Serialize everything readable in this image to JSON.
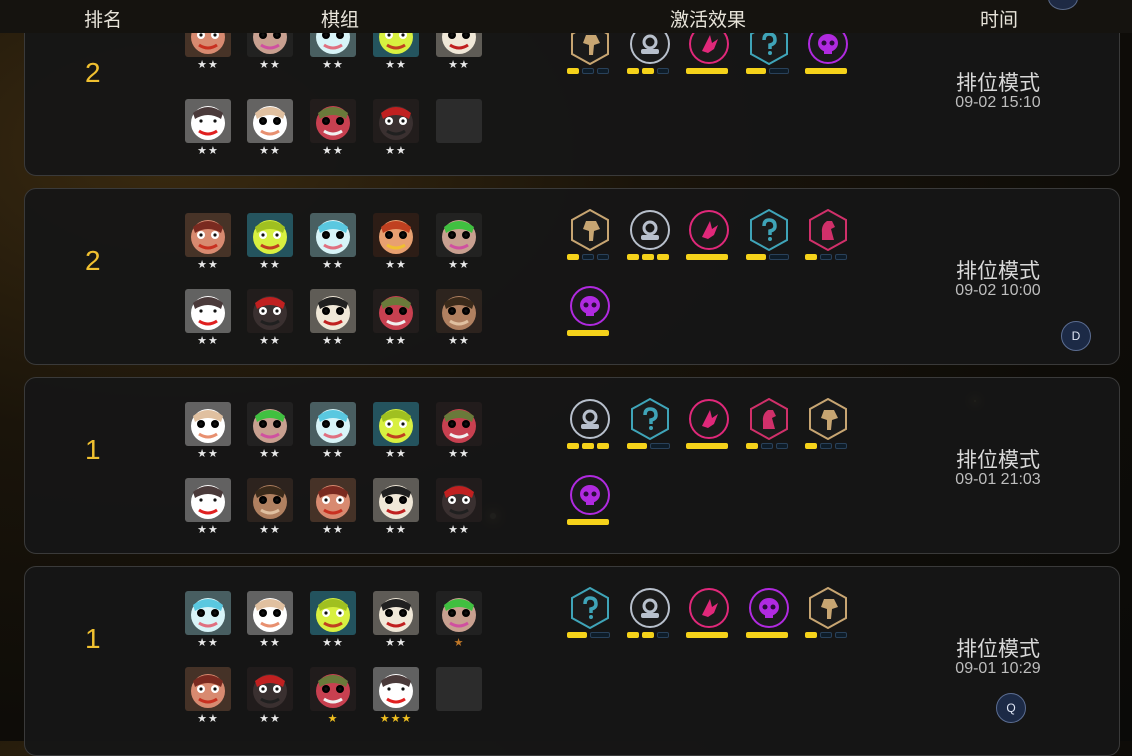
{
  "header": {
    "rank": "排名",
    "comp": "棋组",
    "traits": "激活效果",
    "time": "时间"
  },
  "rows": [
    {
      "rank": "2",
      "mode": "排位模式",
      "time": "09-02 15:10",
      "avatar": "",
      "units": [
        {
          "name": "red-beard-brawler",
          "stars": "★★",
          "star_color": "silver"
        },
        {
          "name": "green-horned-ogre",
          "stars": "★★",
          "star_color": "silver"
        },
        {
          "name": "frost-bear",
          "stars": "★★",
          "star_color": "silver"
        },
        {
          "name": "yellow-frog-mage",
          "stars": "★★",
          "star_color": "silver"
        },
        {
          "name": "skull-warrior",
          "stars": "★★",
          "star_color": "silver"
        },
        {
          "name": "horned-tusk-beast",
          "stars": "★★",
          "star_color": "silver"
        },
        {
          "name": "white-sheep",
          "stars": "★★",
          "star_color": "silver"
        },
        {
          "name": "horned-red-demon",
          "stars": "★★",
          "star_color": "silver"
        },
        {
          "name": "red-hat-bandit",
          "stars": "★★",
          "star_color": "silver"
        },
        {
          "name": "empty-slot",
          "stars": "",
          "star_color": "silver"
        }
      ],
      "traits": [
        {
          "icon": "axe-icon",
          "color": "#c7a572",
          "active": 1,
          "total": 3
        },
        {
          "icon": "helmet-icon",
          "color": "#b8c0cc",
          "active": 2,
          "total": 3
        },
        {
          "icon": "bird-icon",
          "color": "#e0287a",
          "active": 1,
          "total": 1
        },
        {
          "icon": "question-icon",
          "color": "#3fa4b8",
          "active": 1,
          "total": 2
        },
        {
          "icon": "skull-icon",
          "color": "#b02ae0",
          "active": 1,
          "total": 1
        }
      ]
    },
    {
      "rank": "2",
      "mode": "排位模式",
      "time": "09-02 10:00",
      "avatar": "D",
      "units": [
        {
          "name": "red-beard-brawler",
          "stars": "★★",
          "star_color": "silver"
        },
        {
          "name": "yellow-frog-mage",
          "stars": "★★",
          "star_color": "silver"
        },
        {
          "name": "frost-bear",
          "stars": "★★",
          "star_color": "silver"
        },
        {
          "name": "orange-headband-fighter",
          "stars": "★★",
          "star_color": "silver"
        },
        {
          "name": "green-horned-ogre",
          "stars": "★★",
          "star_color": "silver"
        },
        {
          "name": "horned-tusk-beast",
          "stars": "★★",
          "star_color": "silver"
        },
        {
          "name": "red-hat-bandit",
          "stars": "★★",
          "star_color": "silver"
        },
        {
          "name": "skull-warrior",
          "stars": "★★",
          "star_color": "silver"
        },
        {
          "name": "horned-red-demon",
          "stars": "★★",
          "star_color": "silver"
        },
        {
          "name": "long-hair-hunter",
          "stars": "★★",
          "star_color": "silver"
        }
      ],
      "traits": [
        {
          "icon": "axe-icon",
          "color": "#c7a572",
          "active": 1,
          "total": 3
        },
        {
          "icon": "helmet-icon",
          "color": "#b8c0cc",
          "active": 3,
          "total": 3
        },
        {
          "icon": "bird-icon",
          "color": "#e0287a",
          "active": 1,
          "total": 1
        },
        {
          "icon": "question-icon",
          "color": "#3fa4b8",
          "active": 1,
          "total": 2
        },
        {
          "icon": "knight-icon",
          "color": "#d0306a",
          "active": 1,
          "total": 3
        },
        {
          "icon": "skull-icon",
          "color": "#b02ae0",
          "active": 1,
          "total": 1
        }
      ]
    },
    {
      "rank": "1",
      "mode": "排位模式",
      "time": "09-01 21:03",
      "avatar": "",
      "units": [
        {
          "name": "white-sheep",
          "stars": "★★",
          "star_color": "silver"
        },
        {
          "name": "green-horned-ogre",
          "stars": "★★",
          "star_color": "silver"
        },
        {
          "name": "frost-bear",
          "stars": "★★",
          "star_color": "silver"
        },
        {
          "name": "yellow-frog-mage",
          "stars": "★★",
          "star_color": "silver"
        },
        {
          "name": "horned-red-demon",
          "stars": "★★",
          "star_color": "silver"
        },
        {
          "name": "horned-tusk-beast",
          "stars": "★★",
          "star_color": "silver"
        },
        {
          "name": "long-hair-hunter",
          "stars": "★★",
          "star_color": "silver"
        },
        {
          "name": "red-beard-brawler",
          "stars": "★★",
          "star_color": "silver"
        },
        {
          "name": "skull-warrior",
          "stars": "★★",
          "star_color": "silver"
        },
        {
          "name": "red-hat-bandit",
          "stars": "★★",
          "star_color": "silver"
        }
      ],
      "traits": [
        {
          "icon": "helmet-icon",
          "color": "#b8c0cc",
          "active": 3,
          "total": 3
        },
        {
          "icon": "question-icon",
          "color": "#3fa4b8",
          "active": 1,
          "total": 2
        },
        {
          "icon": "bird-icon",
          "color": "#e0287a",
          "active": 1,
          "total": 1
        },
        {
          "icon": "knight-icon",
          "color": "#d0306a",
          "active": 1,
          "total": 3
        },
        {
          "icon": "axe-icon",
          "color": "#c7a572",
          "active": 1,
          "total": 3
        },
        {
          "icon": "skull-icon",
          "color": "#b02ae0",
          "active": 1,
          "total": 1
        }
      ]
    },
    {
      "rank": "1",
      "mode": "排位模式",
      "time": "09-01 10:29",
      "avatar": "Q",
      "units": [
        {
          "name": "frost-bear",
          "stars": "★★",
          "star_color": "silver"
        },
        {
          "name": "white-sheep",
          "stars": "★★",
          "star_color": "silver"
        },
        {
          "name": "yellow-frog-mage",
          "stars": "★★",
          "star_color": "silver"
        },
        {
          "name": "skull-warrior",
          "stars": "★★",
          "star_color": "silver"
        },
        {
          "name": "green-horned-ogre",
          "stars": "★",
          "star_color": "bronze"
        },
        {
          "name": "red-beard-brawler",
          "stars": "★★",
          "star_color": "silver"
        },
        {
          "name": "red-hat-bandit",
          "stars": "★★",
          "star_color": "silver"
        },
        {
          "name": "horned-red-demon",
          "stars": "★",
          "star_color": "gold"
        },
        {
          "name": "horned-tusk-beast",
          "stars": "★★★",
          "star_color": "gold"
        },
        {
          "name": "empty-slot",
          "stars": "",
          "star_color": "silver"
        }
      ],
      "traits": [
        {
          "icon": "question-icon",
          "color": "#3fa4b8",
          "active": 1,
          "total": 2
        },
        {
          "icon": "helmet-icon",
          "color": "#b8c0cc",
          "active": 2,
          "total": 3
        },
        {
          "icon": "bird-icon",
          "color": "#e0287a",
          "active": 1,
          "total": 1
        },
        {
          "icon": "skull-icon",
          "color": "#b02ae0",
          "active": 1,
          "total": 1
        },
        {
          "icon": "axe-icon",
          "color": "#c7a572",
          "active": 1,
          "total": 3
        }
      ]
    }
  ]
}
